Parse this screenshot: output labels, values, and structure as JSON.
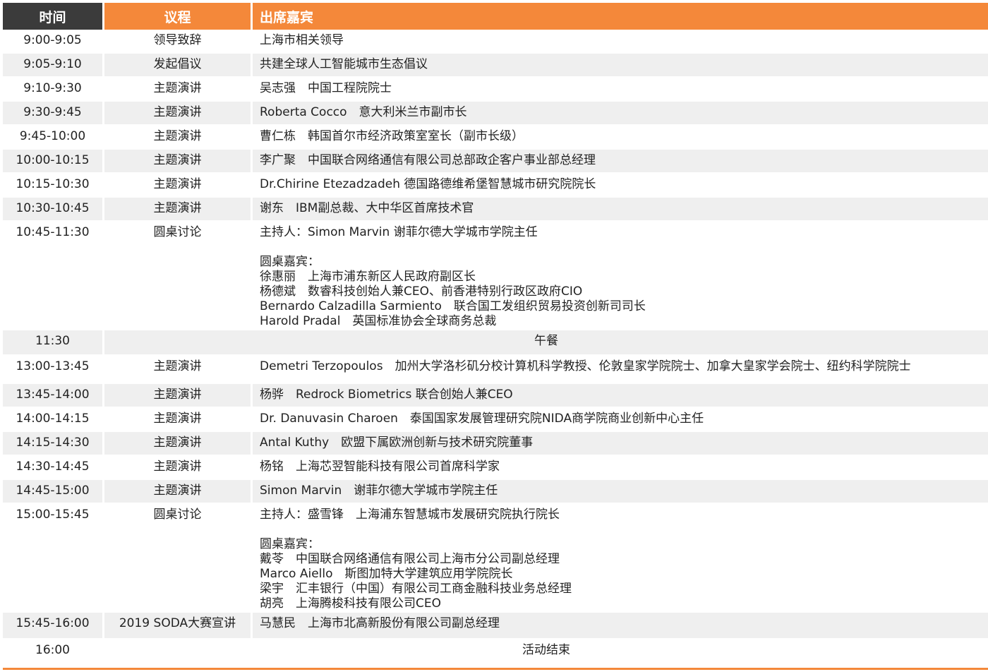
{
  "table": {
    "headers": {
      "time": "时间",
      "agenda": "议程",
      "speakers": "出席嘉宾"
    },
    "rows": [
      {
        "time": "9:00-9:05",
        "agenda": "领导致辞",
        "lines": [
          "上海市相关领导"
        ]
      },
      {
        "time": "9:05-9:10",
        "agenda": "发起倡议",
        "lines": [
          "共建全球人工智能城市生态倡议"
        ]
      },
      {
        "time": "9:10-9:30",
        "agenda": "主题演讲",
        "lines": [
          "吴志强　中国工程院院士"
        ]
      },
      {
        "time": "9:30-9:45",
        "agenda": "主题演讲",
        "lines": [
          "Roberta Cocco　意大利米兰市副市长"
        ]
      },
      {
        "time": "9:45-10:00",
        "agenda": "主题演讲",
        "lines": [
          "曹仁栋　韩国首尔市经济政策室室长（副市长级）"
        ]
      },
      {
        "time": "10:00-10:15",
        "agenda": "主题演讲",
        "lines": [
          "李广聚　中国联合网络通信有限公司总部政企客户事业部总经理"
        ]
      },
      {
        "time": "10:15-10:30",
        "agenda": "主题演讲",
        "lines": [
          "Dr.Chirine Etezadzadeh 德国路德维希堡智慧城市研究院院长"
        ]
      },
      {
        "time": "10:30-10:45",
        "agenda": "主题演讲",
        "lines": [
          "谢东　IBM副总裁、大中华区首席技术官"
        ]
      },
      {
        "time": "10:45-11:30",
        "agenda": "圆桌讨论",
        "lines": [
          "主持人：Simon Marvin 谢菲尔德大学城市学院主任",
          "",
          "圆桌嘉宾：",
          "徐惠丽　上海市浦东新区人民政府副区长",
          "杨德斌　数睿科技创始人兼CEO、前香港特别行政区政府CIO",
          "Bernardo Calzadilla Sarmiento　联合国工发组织贸易投资创新司司长",
          "Harold Pradal　英国标准协会全球商务总裁"
        ]
      },
      {
        "time": "11:30",
        "note": "午餐"
      },
      {
        "time": "13:00-13:45",
        "agenda": "主题演讲",
        "lines": [
          "Demetri Terzopoulos　加州大学洛杉矶分校计算机科学教授、伦敦皇家学院院士、加拿大皇家学会院士、纽约科学院院士"
        ]
      },
      {
        "time": "13:45-14:00",
        "agenda": "主题演讲",
        "lines": [
          "杨骅　Redrock Biometrics 联合创始人兼CEO"
        ]
      },
      {
        "time": "14:00-14:15",
        "agenda": "主题演讲",
        "lines": [
          "Dr. Danuvasin Charoen　泰国国家发展管理研究院NIDA商学院商业创新中心主任"
        ]
      },
      {
        "time": "14:15-14:30",
        "agenda": "主题演讲",
        "lines": [
          "Antal Kuthy　欧盟下属欧洲创新与技术研究院董事"
        ]
      },
      {
        "time": "14:30-14:45",
        "agenda": "主题演讲",
        "lines": [
          "杨铭　上海芯翌智能科技有限公司首席科学家"
        ]
      },
      {
        "time": "14:45-15:00",
        "agenda": "主题演讲",
        "lines": [
          "Simon Marvin　谢菲尔德大学城市学院主任"
        ]
      },
      {
        "time": "15:00-15:45",
        "agenda": "圆桌讨论",
        "lines": [
          "主持人：盛雪锋　上海浦东智慧城市发展研究院执行院长",
          "",
          "圆桌嘉宾：",
          "戴苓　中国联合网络通信有限公司上海市分公司副总经理",
          "Marco Aiello　斯图加特大学建筑应用学院院长",
          "梁宇　汇丰银行（中国）有限公司工商金融科技业务总经理",
          "胡亮　上海腾梭科技有限公司CEO"
        ]
      },
      {
        "time": "15:45-16:00",
        "agenda": "2019 SODA大赛宣讲",
        "lines": [
          "马慧民　上海市北高新股份有限公司副总经理"
        ]
      },
      {
        "time": "16:00",
        "note": "活动结束"
      }
    ]
  },
  "colors": {
    "header_orange": "#f4883a",
    "header_dark": "#3b3b3b",
    "stripe": "#efefef"
  }
}
